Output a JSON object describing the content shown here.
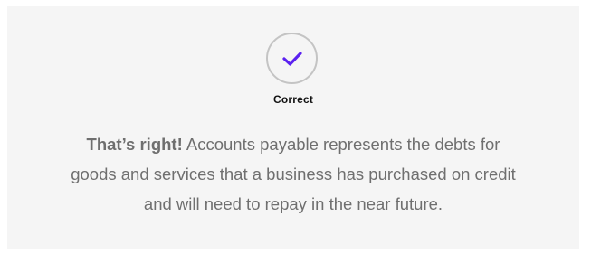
{
  "result": {
    "status_label": "Correct",
    "check_color": "#5b21f0",
    "icon": "checkmark-icon"
  },
  "feedback": {
    "lead": "That’s right!",
    "body": "Accounts payable represents the debts for goods and services that a business has purchased on credit and will need to repay in the near future."
  }
}
